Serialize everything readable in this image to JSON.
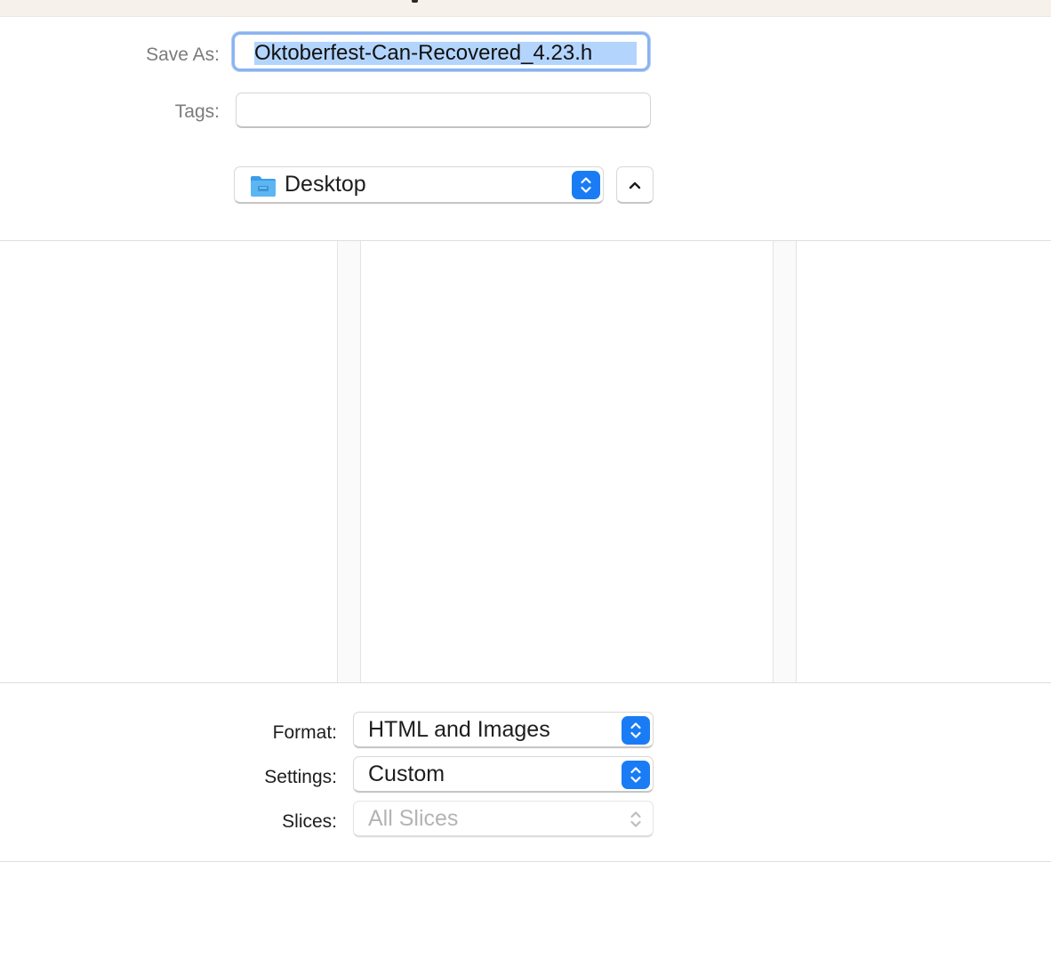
{
  "save_as": {
    "label": "Save As:",
    "value": "Oktoberfest-Can-Recovered_4.23.h"
  },
  "tags": {
    "label": "Tags:",
    "value": ""
  },
  "location": {
    "folder": "Desktop",
    "folder_icon": "folder-icon",
    "collapse_icon": "chevron-up-icon"
  },
  "options": {
    "format": {
      "label": "Format:",
      "value": "HTML and Images"
    },
    "settings": {
      "label": "Settings:",
      "value": "Custom"
    },
    "slices": {
      "label": "Slices:",
      "value": "All Slices",
      "disabled": true
    }
  },
  "colors": {
    "accent": "#1a7cf5",
    "selection": "#b3d5fd",
    "focus_ring": "#8ab3f2",
    "folder": "#4aa8ec",
    "titlebar": "#f6f1eb"
  }
}
